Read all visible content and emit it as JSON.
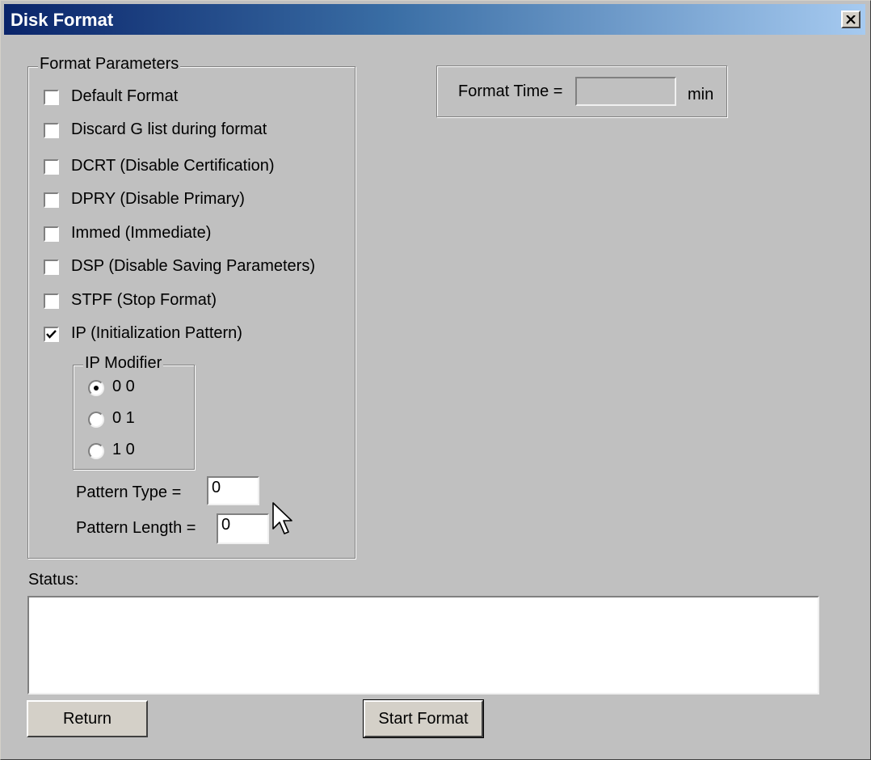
{
  "window": {
    "title": "Disk Format",
    "close_label": "X"
  },
  "format_parameters": {
    "legend": "Format Parameters",
    "options": [
      {
        "label": "Default Format",
        "checked": false
      },
      {
        "label": "Discard G list during format",
        "checked": false
      },
      {
        "label": "DCRT (Disable Certification)",
        "checked": false
      },
      {
        "label": "DPRY (Disable Primary)",
        "checked": false
      },
      {
        "label": "Immed (Immediate)",
        "checked": false
      },
      {
        "label": "DSP (Disable Saving Parameters)",
        "checked": false
      },
      {
        "label": "STPF (Stop Format)",
        "checked": false
      },
      {
        "label": "IP (Initialization Pattern)",
        "checked": true
      }
    ],
    "ip_modifier": {
      "legend": "IP Modifier",
      "options": [
        {
          "label": "0 0",
          "selected": true
        },
        {
          "label": "0 1",
          "selected": false
        },
        {
          "label": "1 0",
          "selected": false
        }
      ]
    },
    "pattern_type": {
      "label": "Pattern Type =",
      "value": "0"
    },
    "pattern_length": {
      "label": "Pattern Length =",
      "value": "0"
    }
  },
  "format_time": {
    "label": "Format Time =",
    "value": "",
    "unit": "min"
  },
  "status": {
    "label": "Status:",
    "text": ""
  },
  "buttons": {
    "return_label": "Return",
    "start_format_label": "Start Format"
  }
}
